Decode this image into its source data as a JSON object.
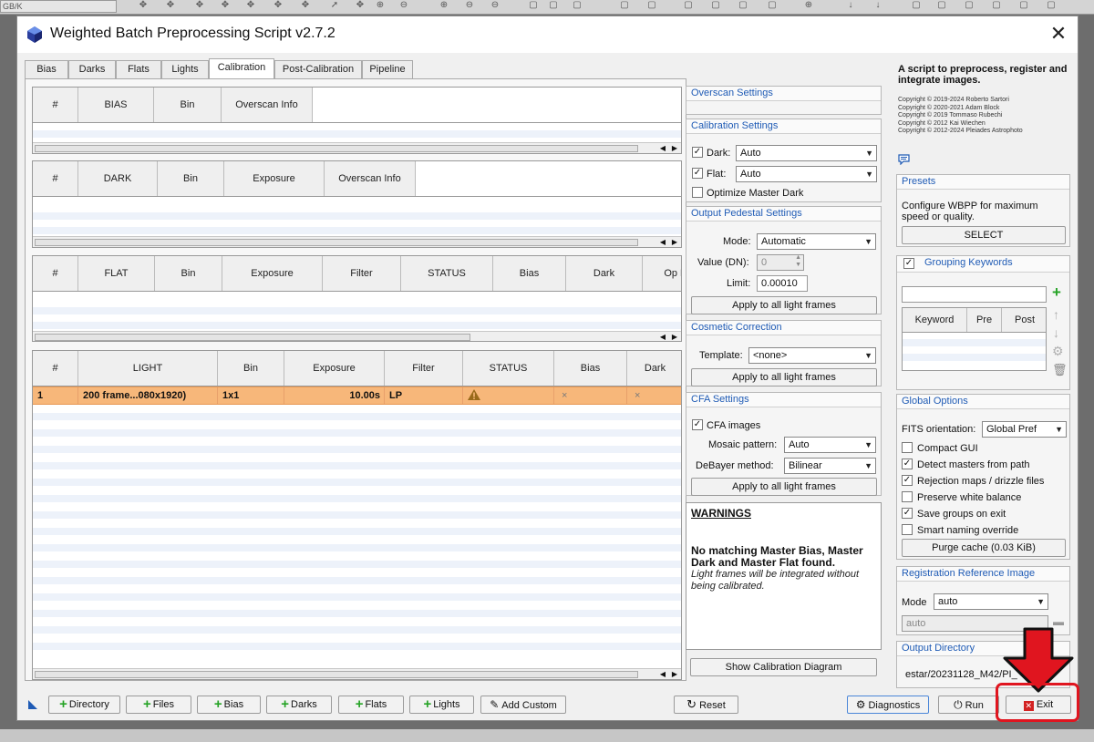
{
  "app": {
    "toolbar_dropdown": "GB/K",
    "title": "Weighted Batch Preprocessing Script v2.7.2",
    "close_glyph": "✕"
  },
  "tabs": [
    "Bias",
    "Darks",
    "Flats",
    "Lights",
    "Calibration",
    "Post-Calibration",
    "Pipeline"
  ],
  "tables": {
    "bias": {
      "headers": [
        "#",
        "BIAS",
        "Bin",
        "Overscan Info"
      ]
    },
    "dark": {
      "headers": [
        "#",
        "DARK",
        "Bin",
        "Exposure",
        "Overscan Info"
      ]
    },
    "flat": {
      "headers": [
        "#",
        "FLAT",
        "Bin",
        "Exposure",
        "Filter",
        "STATUS",
        "Bias",
        "Dark",
        "Op D"
      ]
    },
    "light": {
      "headers": [
        "#",
        "LIGHT",
        "Bin",
        "Exposure",
        "Filter",
        "STATUS",
        "Bias",
        "Dark"
      ],
      "rows": [
        {
          "num": "1",
          "light": "200 frame...080x1920)",
          "bin": "1x1",
          "exposure": "10.00s",
          "filter": "LP",
          "bias": "×",
          "dark": "×"
        }
      ]
    }
  },
  "overscan": {
    "title": "Overscan Settings"
  },
  "calibration": {
    "title": "Calibration Settings",
    "dark_label": "Dark:",
    "dark_value": "Auto",
    "flat_label": "Flat:",
    "flat_value": "Auto",
    "optimize_label": "Optimize Master Dark"
  },
  "pedestal": {
    "title": "Output Pedestal Settings",
    "mode_label": "Mode:",
    "mode_value": "Automatic",
    "value_label": "Value (DN):",
    "value_value": "0",
    "limit_label": "Limit:",
    "limit_value": "0.00010",
    "apply": "Apply to all light frames"
  },
  "cosmetic": {
    "title": "Cosmetic Correction",
    "template_label": "Template:",
    "template_value": "<none>",
    "apply": "Apply to all light frames"
  },
  "cfa": {
    "title": "CFA Settings",
    "cfa_label": "CFA images",
    "mosaic_label": "Mosaic pattern:",
    "mosaic_value": "Auto",
    "debayer_label": "DeBayer method:",
    "debayer_value": "Bilinear",
    "apply": "Apply to all light frames"
  },
  "warnings": {
    "title": "WARNINGS",
    "bold": "No matching Master Bias, Master Dark and Master Flat found.",
    "italic": "Light frames will be integrated without being calibrated."
  },
  "show_diagram": "Show Calibration Diagram",
  "about": {
    "text": "A script to preprocess, register and integrate images.",
    "copyrights": [
      "Copyright © 2019-2024 Roberto Sartori",
      "Copyright © 2020-2021 Adam Block",
      "Copyright © 2019 Tommaso Rubechi",
      "Copyright © 2012 Kai Wiechen",
      "Copyright © 2012-2024 Pleiades Astrophoto"
    ]
  },
  "presets": {
    "title": "Presets",
    "text": "Configure WBPP for maximum speed or quality.",
    "button": "SELECT"
  },
  "grouping": {
    "title": "Grouping Keywords",
    "headers": [
      "Keyword",
      "Pre",
      "Post"
    ]
  },
  "global": {
    "title": "Global Options",
    "fits_label": "FITS orientation:",
    "fits_value": "Global Pref",
    "options": [
      {
        "label": "Compact GUI",
        "checked": false
      },
      {
        "label": "Detect masters from path",
        "checked": true
      },
      {
        "label": "Rejection maps / drizzle files",
        "checked": true
      },
      {
        "label": "Preserve white balance",
        "checked": false
      },
      {
        "label": "Save groups on exit",
        "checked": true
      },
      {
        "label": "Smart naming override",
        "checked": false
      }
    ],
    "purge": "Purge cache (0.03 KiB)"
  },
  "registration": {
    "title": "Registration Reference Image",
    "mode_label": "Mode",
    "mode_value": "auto",
    "ref_value": "auto"
  },
  "output": {
    "title": "Output Directory",
    "path": "estar/20231128_M42/PI_"
  },
  "bottom": {
    "directory": "Directory",
    "files": "Files",
    "bias": "Bias",
    "darks": "Darks",
    "flats": "Flats",
    "lights": "Lights",
    "add_custom": "Add Custom",
    "reset": "Reset",
    "diagnostics": "Diagnostics",
    "run": "Run",
    "exit": "Exit"
  },
  "colors": {
    "accent": "#1f5bb5",
    "selected_row": "#f7b77a",
    "highlight": "#e0151f"
  }
}
